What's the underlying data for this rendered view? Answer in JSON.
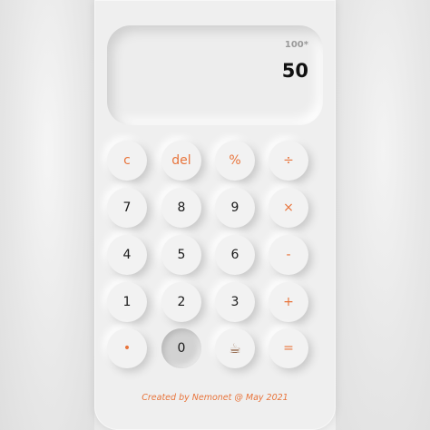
{
  "display": {
    "history": "100*",
    "result": "50"
  },
  "keys": {
    "row1": [
      "c",
      "del",
      "%",
      "÷"
    ],
    "row2": [
      "7",
      "8",
      "9",
      "×"
    ],
    "row3": [
      "4",
      "5",
      "6",
      "-"
    ],
    "row4": [
      "1",
      "2",
      "3",
      "+"
    ],
    "row5": [
      "•",
      "0",
      "☕",
      "="
    ]
  },
  "credit": "Created by Nemonet @ May 2021",
  "colors": {
    "accent": "#e8743b",
    "surface": "#efefef",
    "pressed_key": "#d2d2d2"
  },
  "icons": {
    "coffee_key": "coffee-cup-icon"
  }
}
